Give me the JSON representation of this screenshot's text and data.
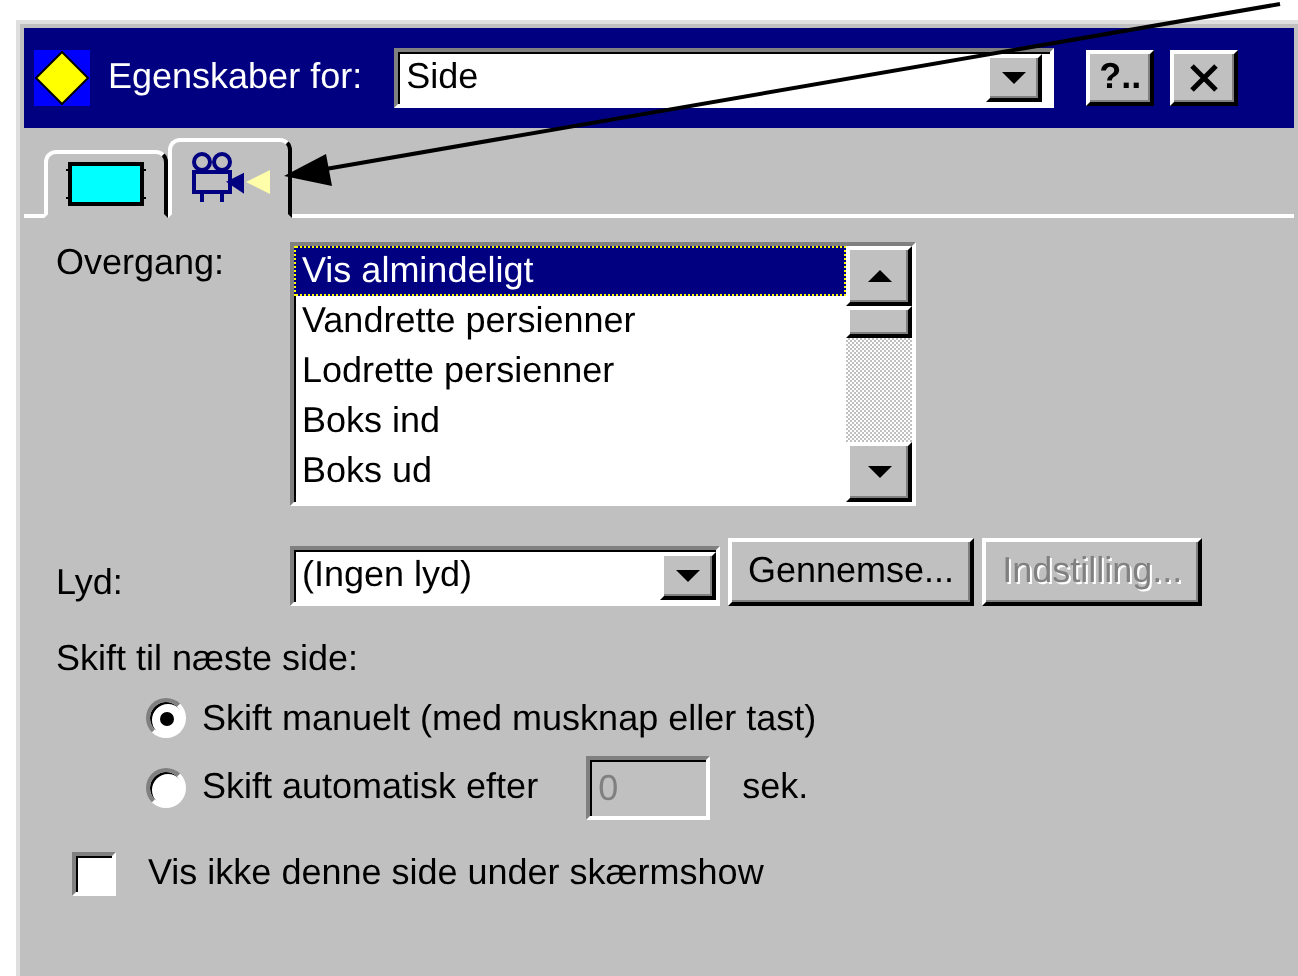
{
  "title_bar": {
    "label": "Egenskaber for:",
    "object_select": {
      "value": "Side"
    },
    "help_button": "?.."
  },
  "tabs": [
    {
      "kind": "slide",
      "selected": false
    },
    {
      "kind": "transition",
      "selected": true
    }
  ],
  "transition": {
    "label": "Overgang:",
    "items": [
      {
        "label": "Vis almindeligt",
        "selected": true
      },
      {
        "label": "Vandrette persienner",
        "selected": false
      },
      {
        "label": "Lodrette persienner",
        "selected": false
      },
      {
        "label": "Boks ind",
        "selected": false
      },
      {
        "label": "Boks ud",
        "selected": false
      }
    ]
  },
  "sound": {
    "label": "Lyd:",
    "value": "(Ingen lyd)",
    "buttons": [
      {
        "label": "Gennemse...",
        "disabled": false
      },
      {
        "label": "Indstilling...",
        "disabled": true
      }
    ]
  },
  "advance": {
    "label": "Skift til næste side:",
    "options": [
      {
        "kind": "manual",
        "label": "Skift manuelt (med musknap eller tast)",
        "selected": true
      },
      {
        "kind": "automatic",
        "label": "Skift automatisk efter",
        "selected": false
      }
    ],
    "seconds": {
      "value": "0",
      "disabled": true
    },
    "unit": "sek."
  },
  "hide_slide": {
    "label": "Vis ikke denne side under skærmshow",
    "checked": false
  }
}
